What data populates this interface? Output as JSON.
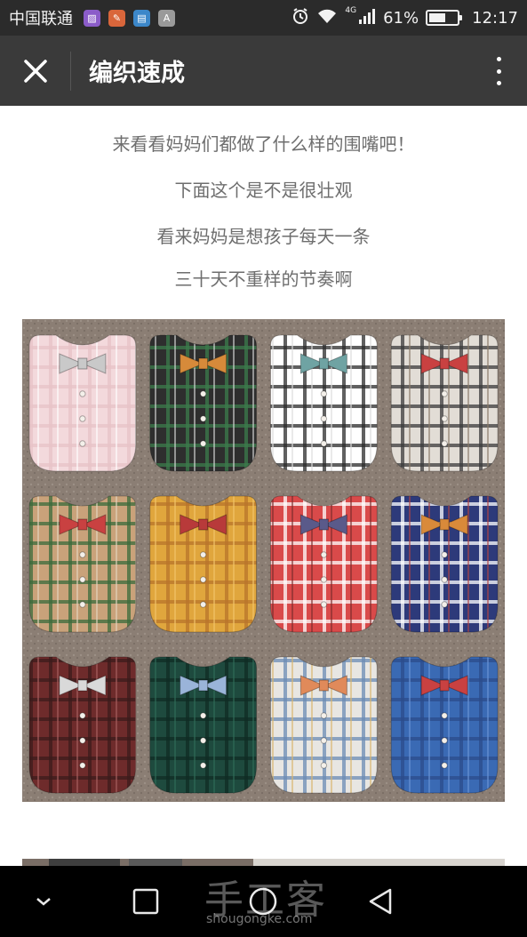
{
  "status_bar": {
    "carrier": "中国联通",
    "app_icons": [
      {
        "name": "gallery-app-icon",
        "glyph": "▨",
        "color": "#8b5cc9"
      },
      {
        "name": "tools-app-icon",
        "glyph": "✎",
        "color": "#d9663b"
      },
      {
        "name": "notes-app-icon",
        "glyph": "▤",
        "color": "#3c87c9"
      },
      {
        "name": "font-app-icon",
        "glyph": "A",
        "color": "#9a9a9a"
      }
    ],
    "network": "4G",
    "battery": "61%",
    "battery_level": 0.61,
    "time": "12:17"
  },
  "title_bar": {
    "title": "编织速成"
  },
  "article": {
    "lines": [
      "来看看妈妈们都做了什么样的围嘴吧！",
      "下面这个是不是很壮观",
      "看来妈妈是想孩子每天一条",
      "三十天不重样的节奏啊"
    ]
  },
  "photo": {
    "background": "#8b7e74",
    "bibs": [
      {
        "colors": [
          "#f3d9dc",
          "#e6c3c7",
          "#ffffff"
        ],
        "bow": "#c9c9c9"
      },
      {
        "colors": [
          "#2e2e2e",
          "#3b7a4b",
          "#d9d9d9"
        ],
        "bow": "#d68a3a"
      },
      {
        "colors": [
          "#ffffff",
          "#2a2a2a",
          "#dcdcdc"
        ],
        "bow": "#6fa3a3"
      },
      {
        "colors": [
          "#e2ddd6",
          "#3a3a3a",
          "#8a7a68"
        ],
        "bow": "#c94141"
      },
      {
        "colors": [
          "#c9a27a",
          "#3a6a3a",
          "#e4d6bf"
        ],
        "bow": "#c94141"
      },
      {
        "colors": [
          "#e0a63d",
          "#b8742a",
          "#f2c46a"
        ],
        "bow": "#b83a3a"
      },
      {
        "colors": [
          "#d94a4a",
          "#ffffff",
          "#7a2a2a"
        ],
        "bow": "#5a5a8a"
      },
      {
        "colors": [
          "#2d3a7a",
          "#ffffff",
          "#b04242"
        ],
        "bow": "#d98a3a"
      },
      {
        "colors": [
          "#6e2b2b",
          "#3a1a1a",
          "#a86060"
        ],
        "bow": "#d9d9d9"
      },
      {
        "colors": [
          "#1e4a3e",
          "#0f2a22",
          "#2f6a56"
        ],
        "bow": "#9ab4d9"
      },
      {
        "colors": [
          "#e8e6e2",
          "#6a8ab4",
          "#d9b46a"
        ],
        "bow": "#e08a5a"
      },
      {
        "colors": [
          "#3a6ab4",
          "#2a4a8a",
          "#6a94d6"
        ],
        "bow": "#c94141"
      }
    ]
  },
  "nav_bar": {
    "watermark": "手工客",
    "watermark_url": "shougongke.com"
  }
}
